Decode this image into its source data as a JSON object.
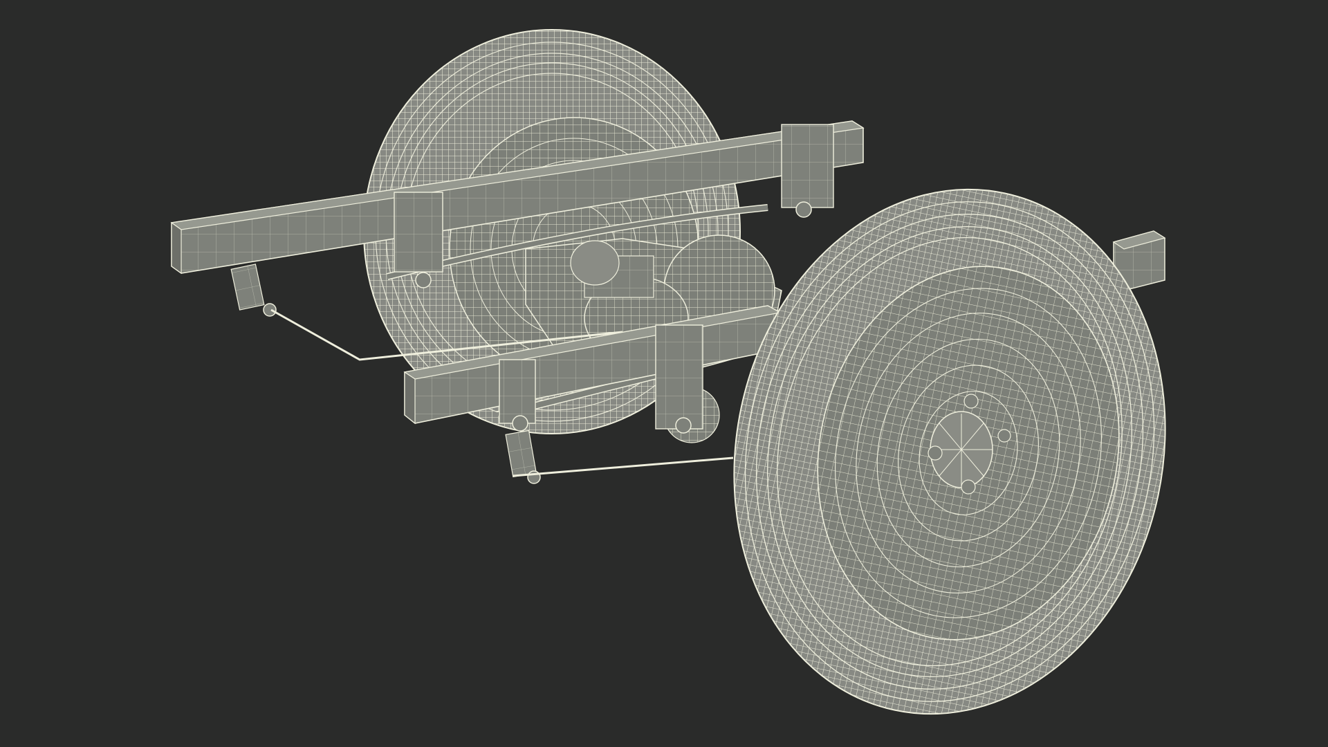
{
  "scene": {
    "subject": "wireframe-rear-axle-assembly",
    "colors": {
      "background": "#2a2b2a",
      "solid": "#7e817a",
      "solid_dark": "#5f625c",
      "solid_light": "#9a9d95",
      "wire": "#e9e9d6",
      "tire": "#8a8c85",
      "tire_dark": "#6d6f69"
    }
  }
}
